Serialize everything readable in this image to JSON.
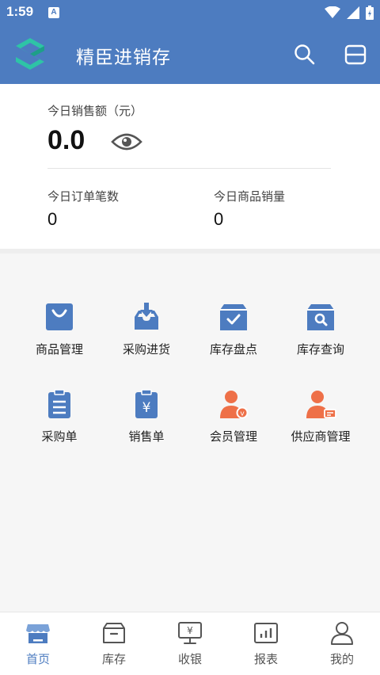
{
  "status_bar": {
    "time": "1:59",
    "notification_icon": "A",
    "icons": [
      "wifi-icon",
      "signal-icon",
      "battery-icon"
    ]
  },
  "app_bar": {
    "title": "精臣进销存",
    "logo_icon": "app-logo-icon",
    "actions": [
      "search-icon",
      "menu-icon"
    ]
  },
  "summary": {
    "sales_label": "今日销售额（元）",
    "sales_amount": "0.0",
    "orders_label": "今日订单笔数",
    "orders_value": "0",
    "goods_label": "今日商品销量",
    "goods_value": "0"
  },
  "grid": [
    {
      "label": "商品管理",
      "icon": "shopping-bag-icon"
    },
    {
      "label": "采购进货",
      "icon": "inbox-download-icon"
    },
    {
      "label": "库存盘点",
      "icon": "stock-check-icon"
    },
    {
      "label": "库存查询",
      "icon": "stock-search-icon"
    },
    {
      "label": "采购单",
      "icon": "purchase-order-icon"
    },
    {
      "label": "销售单",
      "icon": "sales-order-icon"
    },
    {
      "label": "会员管理",
      "icon": "member-icon"
    },
    {
      "label": "供应商管理",
      "icon": "supplier-icon"
    }
  ],
  "bottom_nav": [
    {
      "label": "首页",
      "icon": "home-store-icon",
      "active": true
    },
    {
      "label": "库存",
      "icon": "inventory-box-icon",
      "active": false
    },
    {
      "label": "收银",
      "icon": "cashier-monitor-icon",
      "active": false
    },
    {
      "label": "报表",
      "icon": "report-chart-icon",
      "active": false
    },
    {
      "label": "我的",
      "icon": "profile-icon",
      "active": false
    }
  ],
  "colors": {
    "primary": "#4d7cc0",
    "icon_blue": "#4d7cc0",
    "icon_orange": "#ee7048",
    "logo_teal": "#2ec4a6"
  }
}
